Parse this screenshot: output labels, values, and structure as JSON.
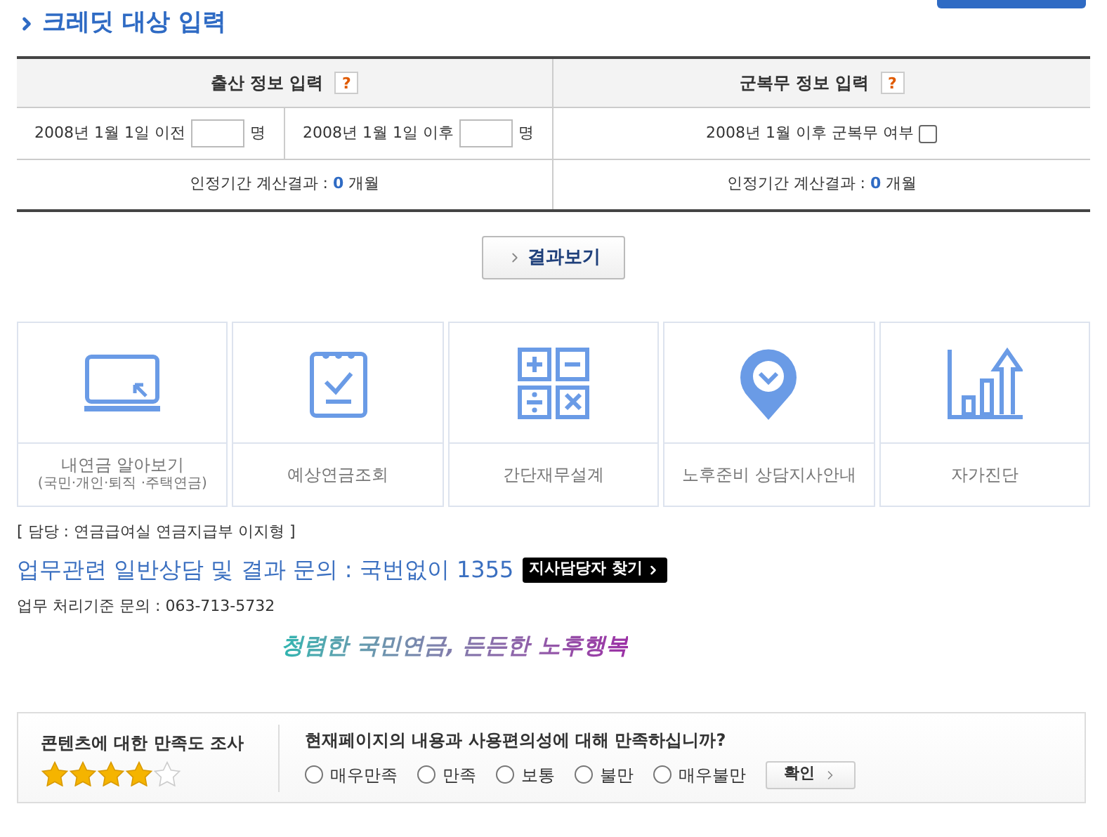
{
  "page_title": "크레딧 대상 입력",
  "sections": [
    {
      "heading": "출산 정보 입력",
      "help": "?",
      "result_label": "인정기간 계산결과 :",
      "result_value": "0",
      "result_unit": "개월"
    },
    {
      "heading": "군복무 정보 입력",
      "help": "?",
      "result_label": "인정기간 계산결과 :",
      "result_value": "0",
      "result_unit": "개월"
    }
  ],
  "birth_fields": [
    {
      "label": "2008년 1월 1일 이전",
      "unit": "명"
    },
    {
      "label": "2008년 1월 1일 이후",
      "unit": "명"
    }
  ],
  "military": {
    "label": "2008년 1월 이후 군복무 여부",
    "checked": false
  },
  "result_button": "결과보기",
  "cards": [
    {
      "kind": "monitor",
      "title": "내연금 알아보기",
      "subtitle": "(국민·개인·퇴직 ·주택연금)"
    },
    {
      "kind": "notepad",
      "title": "예상연금조회"
    },
    {
      "kind": "calculator",
      "title": "간단재무설계"
    },
    {
      "kind": "pin",
      "title": "노후준비 상담지사안내"
    },
    {
      "kind": "chart",
      "title": "자가진단"
    }
  ],
  "contact": {
    "manager": "[ 담당 : 연금급여실 연금지급부 이지형 ]",
    "inquiry": "업무관련 일반상담 및 결과 문의 : 국번없이 1355",
    "branch_button": "지사담당자 찾기",
    "standard": "업무 처리기준 문의 : 063-713-5732",
    "slogan": "청렴한 국민연금, 든든한 노후행복"
  },
  "survey": {
    "title": "콘텐츠에 대한 만족도 조사",
    "stars": 4,
    "question": "현재페이지의 내용과 사용편의성에 대해 만족하십니까?",
    "options": [
      {
        "label": "매우만족",
        "selected": false
      },
      {
        "label": "만족",
        "selected": false
      },
      {
        "label": "보통",
        "selected": false
      },
      {
        "label": "불만",
        "selected": false
      },
      {
        "label": "매우불만",
        "selected": false
      }
    ],
    "submit": "확인"
  }
}
